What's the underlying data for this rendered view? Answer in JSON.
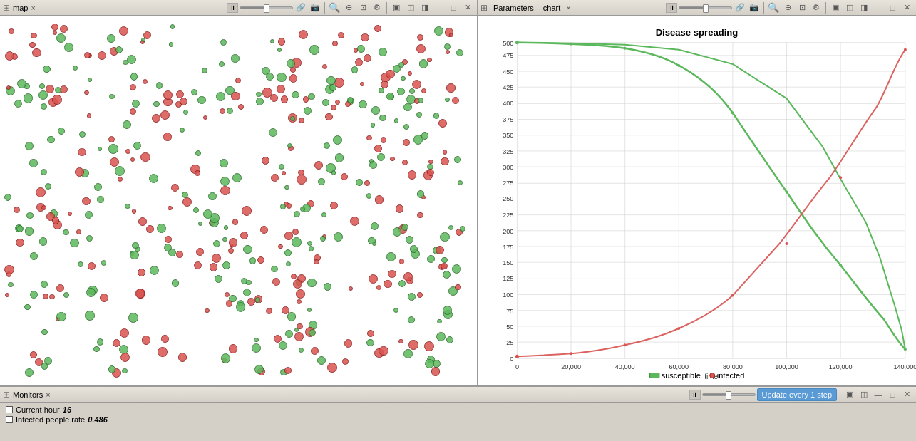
{
  "panels": {
    "left": {
      "title": "map",
      "tab_close": "×"
    },
    "right": {
      "tabs": [
        {
          "label": "Parameters"
        },
        {
          "label": "chart",
          "active": true,
          "close": "×"
        }
      ],
      "chart_title": "Disease spreading",
      "x_axis_label": "time",
      "y_axis": {
        "values": [
          0,
          25,
          50,
          75,
          100,
          125,
          150,
          175,
          200,
          225,
          250,
          275,
          300,
          325,
          350,
          375,
          400,
          425,
          450,
          475,
          500
        ]
      },
      "x_axis": {
        "values": [
          "0",
          "20,000",
          "40,000",
          "60,000",
          "80,000",
          "100,000",
          "120,000",
          "140,000"
        ]
      },
      "legend": [
        {
          "label": "susceptible",
          "color": "#5cb85c"
        },
        {
          "label": "infected",
          "color": "#d9534f"
        }
      ]
    },
    "bottom": {
      "title": "Monitors",
      "tab_close": "×",
      "monitors": [
        {
          "label": "Current hour",
          "value": "16"
        },
        {
          "label": "Infected people rate",
          "value": "0.486"
        }
      ],
      "update_btn_label": "Update every 1 step"
    }
  },
  "icons": {
    "panel_icon": "⊞",
    "close": "×",
    "search_plus": "🔍",
    "link": "🔗",
    "camera": "📷",
    "zoom_in": "+",
    "zoom_out": "-",
    "fit": "⊡",
    "settings": "⚙",
    "layout1": "▣",
    "layout2": "◫",
    "layout3": "◨",
    "minimize": "—",
    "maximize": "□",
    "restore": "⊠",
    "pause": "⏸",
    "step": "⏭"
  }
}
